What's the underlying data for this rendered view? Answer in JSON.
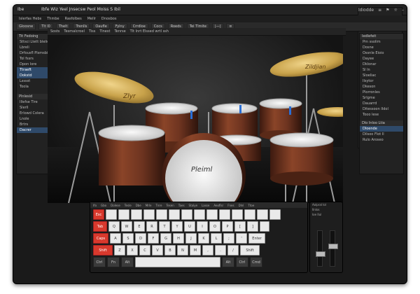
{
  "window": {
    "app": "Ibe",
    "title": "Ibfe Wiz Yeel Jnsecsw Peol Moiss S Ibil",
    "right_items": [
      "ldiodde",
      "≡",
      "⚑",
      "☼",
      "–",
      "□",
      "✕"
    ]
  },
  "menubar": [
    "Islerfas Hebs",
    "Thmbe",
    "Rasfolbes",
    "Mellr",
    "Dnosbos"
  ],
  "toolbar": [
    "Gloosne",
    "Tlt l0",
    "Thelt",
    "Trenlls",
    "Oaufle",
    "Fylny",
    "Crrdloe",
    "Cocs",
    "Roeds",
    "Tei Tlmite",
    "|—|",
    "≡"
  ],
  "left_panel": {
    "header": "Tit Fedoing",
    "items": [
      {
        "label": "Sttsci  Ltett blelie",
        "selected": false
      },
      {
        "label": "Lbreli",
        "selected": false
      },
      {
        "label": "Drfousfl Plsmsbir",
        "selected": false
      },
      {
        "label": "Tol fssrs",
        "selected": false
      },
      {
        "label": "Dpon lore",
        "selected": false
      },
      {
        "label": "Ttraeft",
        "selected": true
      },
      {
        "label": "Dokstd",
        "selected": true
      },
      {
        "label": "Lsssst",
        "selected": false
      },
      {
        "label": "Toola",
        "selected": false
      }
    ],
    "section2_header": "Plnlesid",
    "section2_items": [
      {
        "label": "Illefse Tire",
        "selected": false
      },
      {
        "label": "Slerll",
        "selected": false
      },
      {
        "label": "Erlowd Colera",
        "selected": false
      },
      {
        "label": "Lnole",
        "selected": false
      },
      {
        "label": "Brtrs",
        "selected": false
      },
      {
        "label": "Dacrer",
        "selected": true
      }
    ]
  },
  "stage_bar": [
    "Sosts",
    "Tesmalcroel",
    "Tiss",
    "Tinest",
    "Tenrse"
  ],
  "stage_subbar": [
    "Tlt  Inrt Elssed  wrtl ssh"
  ],
  "drum_brand": "Pleiml",
  "cymbal_brand_left": "Zlyr",
  "cymbal_brand_right": "Zildjian",
  "right_panel": {
    "header": "Iedlefeit",
    "sub": "Prn ssolim",
    "items": [
      {
        "label": "Dosne",
        "selected": false
      },
      {
        "label": "Ossnle Eioio",
        "selected": false
      },
      {
        "label": "Dayee",
        "selected": false
      },
      {
        "label": "Dklonar",
        "selected": false
      },
      {
        "label": "Sl  ln",
        "selected": false
      },
      {
        "label": "Sloeliac",
        "selected": false
      },
      {
        "label": "Ilsytor",
        "selected": false
      },
      {
        "label": "Dkeson",
        "selected": false
      },
      {
        "label": "Plorronles",
        "selected": false
      },
      {
        "label": "Srlgme",
        "selected": false
      },
      {
        "label": "Dauarrd",
        "selected": false
      },
      {
        "label": "Ditessoon Ildol",
        "selected": false
      },
      {
        "label": "Tooo lese",
        "selected": false
      }
    ],
    "section2_header": "Dlo Inloo Ltia",
    "section2_items": [
      {
        "label": "Dloende",
        "selected": true
      },
      {
        "label": "Dilsoo Flot Il",
        "selected": false
      },
      {
        "label": "Rulo Aroseo",
        "selected": false
      }
    ]
  },
  "keyboard": {
    "header": [
      "Ifo",
      "Gbo",
      "Dolese",
      "Tesle",
      "Dbe",
      "Mrle",
      "Tnre",
      "Tesen",
      "Taes",
      "Stalye",
      "Lasse",
      "Aeoflsr",
      "Fnes",
      "Dlnl",
      "Ttoe"
    ],
    "rows": [
      [
        {
          "k": "Tab",
          "c": "red",
          "w": 18
        },
        {
          "k": "Q"
        },
        {
          "k": "W"
        },
        {
          "k": "E"
        },
        {
          "k": "R"
        },
        {
          "k": "T"
        },
        {
          "k": "Y"
        },
        {
          "k": "U"
        },
        {
          "k": "I"
        },
        {
          "k": "O"
        },
        {
          "k": "P"
        },
        {
          "k": "["
        },
        {
          "k": "]"
        },
        {
          "k": "",
          "w": 12
        }
      ],
      [
        {
          "k": "Caps",
          "c": "red",
          "w": 20
        },
        {
          "k": "A"
        },
        {
          "k": "S"
        },
        {
          "k": "D"
        },
        {
          "k": "F"
        },
        {
          "k": "G"
        },
        {
          "k": "H"
        },
        {
          "k": "J"
        },
        {
          "k": "K"
        },
        {
          "k": "L"
        },
        {
          "k": ";"
        },
        {
          "k": "'"
        },
        {
          "k": "Enter",
          "w": 22
        }
      ],
      [
        {
          "k": "Shift",
          "c": "red",
          "w": 26
        },
        {
          "k": "Z"
        },
        {
          "k": "X"
        },
        {
          "k": "C"
        },
        {
          "k": "V"
        },
        {
          "k": "B"
        },
        {
          "k": "N"
        },
        {
          "k": "M"
        },
        {
          "k": ","
        },
        {
          "k": "."
        },
        {
          "k": "/"
        },
        {
          "k": "Shift",
          "w": 26
        }
      ],
      [
        {
          "k": "Ctrl",
          "c": "dark",
          "w": 16
        },
        {
          "k": "Fn",
          "c": "dark",
          "w": 16
        },
        {
          "k": "Alt",
          "c": "dark",
          "w": 16
        },
        {
          "k": "",
          "w": 120
        },
        {
          "k": "Alt",
          "c": "dark",
          "w": 16
        },
        {
          "k": "Ctrl",
          "c": "dark",
          "w": 16
        },
        {
          "k": "Cmd",
          "c": "dark",
          "w": 16
        }
      ]
    ],
    "top_row": [
      {
        "k": "Esc",
        "c": "red",
        "w": 14
      },
      {
        "k": ""
      },
      {
        "k": ""
      },
      {
        "k": ""
      },
      {
        "k": ""
      },
      {
        "k": ""
      },
      {
        "k": ""
      },
      {
        "k": ""
      },
      {
        "k": ""
      },
      {
        "k": ""
      },
      {
        "k": ""
      },
      {
        "k": ""
      },
      {
        "k": ""
      },
      {
        "k": ""
      },
      {
        "k": ""
      }
    ]
  },
  "mixer": {
    "labels": [
      "Aolpral  Iol",
      "Ilnlos",
      "Ioe  Ilul"
    ],
    "levels": [
      0.35,
      0.6
    ]
  },
  "colors": {
    "accent_red": "#d8392d",
    "selection": "#2f4a6a",
    "drum_wood": "#6e3420",
    "cymbal_gold": "#c8a24a"
  }
}
